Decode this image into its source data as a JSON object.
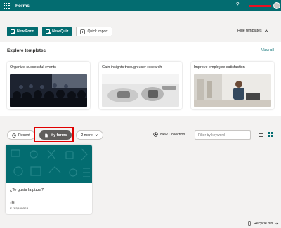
{
  "header": {
    "app_title": "Forms",
    "help_glyph": "?",
    "brand_color": "#036c70"
  },
  "actions": {
    "new_form": "New Form",
    "new_quiz": "New Quiz",
    "quick_import": "Quick import",
    "hide_templates": "Hide templates"
  },
  "templates": {
    "heading": "Explore templates",
    "view_all": "View all",
    "cards": [
      {
        "title": "Organize successful events",
        "image": "audience-photo"
      },
      {
        "title": "Gain insights through user research",
        "image": "vr-headset-photo"
      },
      {
        "title": "Improve employee satisfaction",
        "image": "office-worker-photo"
      }
    ]
  },
  "filters": {
    "recent": "Recent",
    "my_forms": "My forms",
    "more": "2 more",
    "new_collection": "New Collection",
    "search_placeholder": "Filter by keyword"
  },
  "forms": [
    {
      "title": "¿Te gusta la pizza?",
      "responses": "2 responses"
    }
  ],
  "footer": {
    "recycle_bin": "Recycle bin"
  }
}
